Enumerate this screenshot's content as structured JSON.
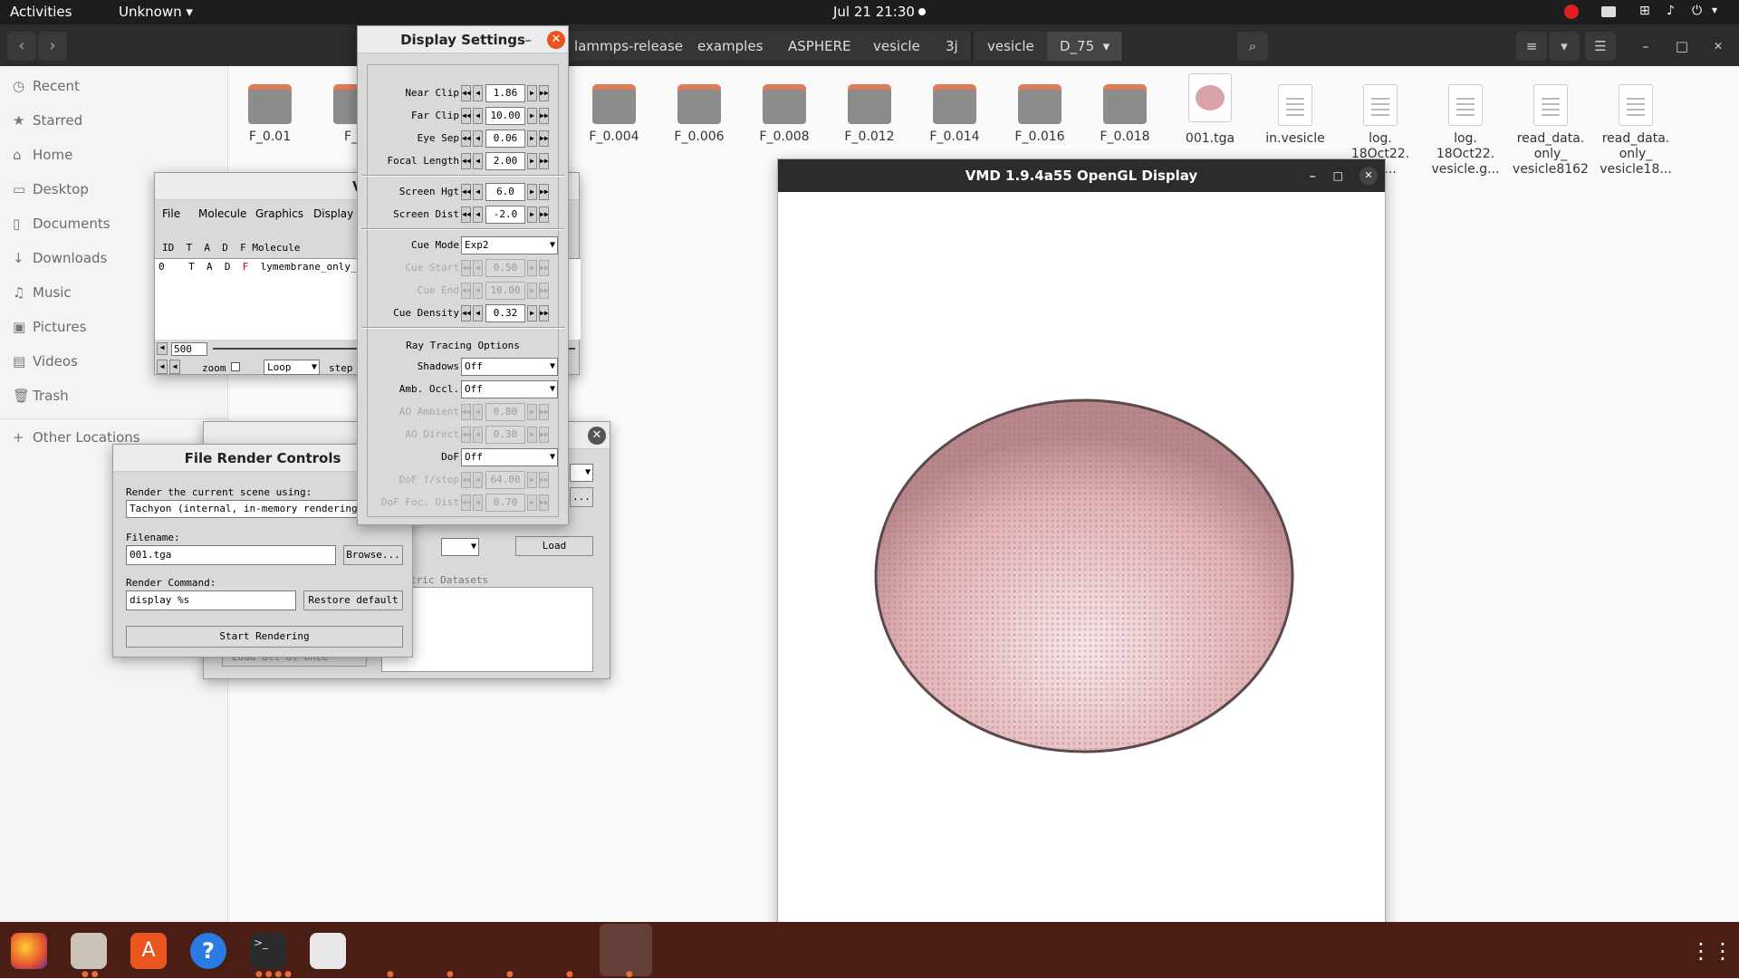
{
  "topbar": {
    "activities": "Activities",
    "app": "Unknown ▾",
    "clock": "Jul 21  21:30"
  },
  "filemanager": {
    "breadcrumbs": [
      "lammps-release",
      "examples",
      "ASPHERE",
      "vesicle",
      "3j",
      "vesicle",
      "D_75"
    ],
    "sidebar": [
      {
        "icon": "clock-icon",
        "label": "Recent"
      },
      {
        "icon": "star-icon",
        "label": "Starred"
      },
      {
        "icon": "home-icon",
        "label": "Home"
      },
      {
        "icon": "desktop-icon",
        "label": "Desktop"
      },
      {
        "icon": "document-icon",
        "label": "Documents"
      },
      {
        "icon": "download-icon",
        "label": "Downloads"
      },
      {
        "icon": "music-icon",
        "label": "Music"
      },
      {
        "icon": "picture-icon",
        "label": "Pictures"
      },
      {
        "icon": "video-icon",
        "label": "Videos"
      },
      {
        "icon": "trash-icon",
        "label": "Trash"
      },
      {
        "icon": "plus-icon",
        "label": "Other Locations"
      }
    ],
    "files": [
      {
        "name": "F_0.01",
        "kind": "folder"
      },
      {
        "name": "F_0",
        "kind": "folder"
      },
      {
        "name": "F_0.004",
        "kind": "folder"
      },
      {
        "name": "F_0.006",
        "kind": "folder"
      },
      {
        "name": "F_0.008",
        "kind": "folder"
      },
      {
        "name": "F_0.012",
        "kind": "folder"
      },
      {
        "name": "F_0.014",
        "kind": "folder"
      },
      {
        "name": "F_0.016",
        "kind": "folder"
      },
      {
        "name": "F_0.018",
        "kind": "folder"
      },
      {
        "name": "001.tga",
        "kind": "image"
      },
      {
        "name": "in.vesicle",
        "kind": "text"
      },
      {
        "name": "log. 18Oct22. e.g...",
        "kind": "text"
      },
      {
        "name": "log. 18Oct22. vesicle.g...",
        "kind": "text"
      },
      {
        "name": "read_data. only_ vesicle8162",
        "kind": "text"
      },
      {
        "name": "read_data. only_ vesicle18...",
        "kind": "text"
      }
    ]
  },
  "vmdmain": {
    "title": "VMI",
    "menu": [
      "File",
      "Molecule",
      "Graphics",
      "Display"
    ],
    "columns": "ID  T  A  D  F Molecule",
    "row": {
      "id": "0",
      "t": "T",
      "a": "A",
      "d": "D",
      "f": "F",
      "name": "lymembrane_only_vesi"
    },
    "frame": "500",
    "zoom": "zoom",
    "loop": "Loop",
    "step": "step"
  },
  "molbrowser": {
    "title": "Mo",
    "load": "Load",
    "datasets": "tric Datasets",
    "loadall": "Load all at once",
    "more": "..."
  },
  "render": {
    "title": "File Render Controls",
    "render_label": "Render the current scene using:",
    "renderer": "Tachyon (internal, in-memory rendering)",
    "filename_label": "Filename:",
    "filename": "001.tga",
    "browse": "Browse...",
    "command_label": "Render Command:",
    "command": "display %s",
    "restore": "Restore default",
    "start": "Start Rendering"
  },
  "display": {
    "title": "Display Settings",
    "minimize": "–",
    "near_clip": {
      "label": "Near Clip",
      "value": "1.86"
    },
    "far_clip": {
      "label": "Far Clip",
      "value": "10.00"
    },
    "eye_sep": {
      "label": "Eye Sep",
      "value": "0.06"
    },
    "focal_length": {
      "label": "Focal Length",
      "value": "2.00"
    },
    "screen_hgt": {
      "label": "Screen Hgt",
      "value": "6.0"
    },
    "screen_dist": {
      "label": "Screen Dist",
      "value": "-2.0"
    },
    "cue_mode": {
      "label": "Cue Mode",
      "value": "Exp2"
    },
    "cue_start": {
      "label": "Cue Start",
      "value": "0.50"
    },
    "cue_end": {
      "label": "Cue End",
      "value": "10.00"
    },
    "cue_density": {
      "label": "Cue Density",
      "value": "0.32"
    },
    "ray_heading": "Ray Tracing Options",
    "shadows": {
      "label": "Shadows",
      "value": "Off"
    },
    "amb_occl": {
      "label": "Amb. Occl.",
      "value": "Off"
    },
    "ao_ambient": {
      "label": "AO Ambient",
      "value": "0.80"
    },
    "ao_direct": {
      "label": "AO Direct",
      "value": "0.30"
    },
    "dof": {
      "label": "DoF",
      "value": "Off"
    },
    "dof_fstop": {
      "label": "DoF f/stop",
      "value": "64.00"
    },
    "dof_focdist": {
      "label": "DoF Foc. Dist",
      "value": "0.70"
    }
  },
  "gl": {
    "title": "VMD 1.9.4a55 OpenGL Display",
    "vesicle_color": "#e3b3b6"
  },
  "colors": {
    "accent": "#e9541f",
    "dock": "#4a1e14"
  }
}
